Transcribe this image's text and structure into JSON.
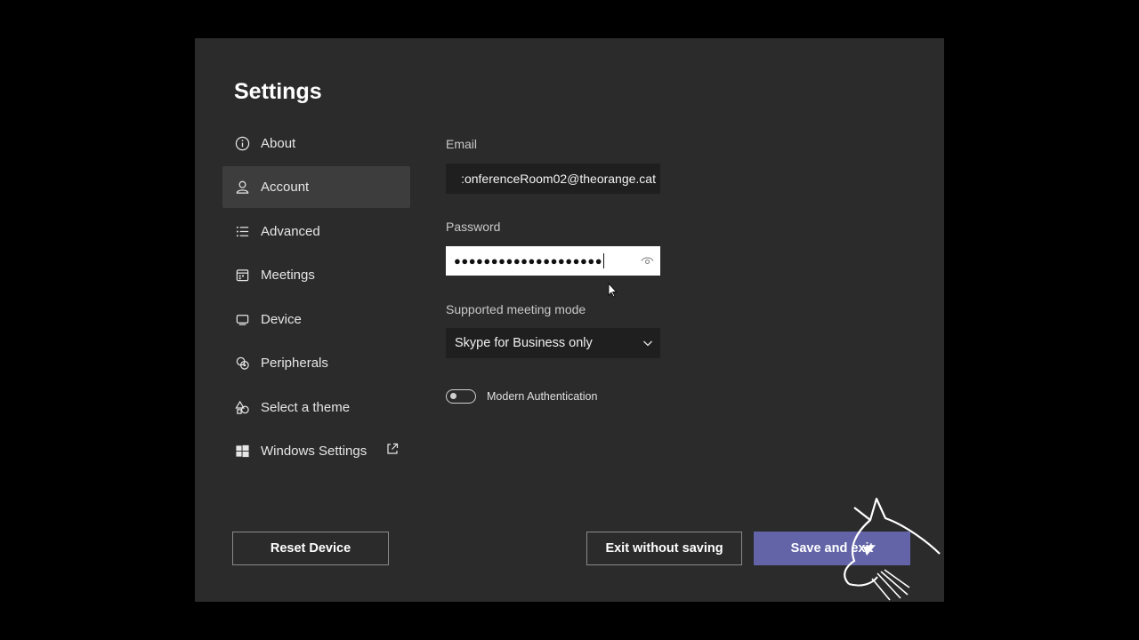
{
  "page": {
    "title": "Settings"
  },
  "sidebar": {
    "items": [
      {
        "label": "About",
        "icon": "info-icon"
      },
      {
        "label": "Account",
        "icon": "person-icon",
        "active": true
      },
      {
        "label": "Advanced",
        "icon": "list-icon"
      },
      {
        "label": "Meetings",
        "icon": "calendar-icon"
      },
      {
        "label": "Device",
        "icon": "device-icon"
      },
      {
        "label": "Peripherals",
        "icon": "peripherals-icon"
      },
      {
        "label": "Select a theme",
        "icon": "shapes-icon"
      },
      {
        "label": "Windows Settings",
        "icon": "windows-icon",
        "external": true
      }
    ]
  },
  "account": {
    "email_label": "Email",
    "email_value": ":onferenceRoom02@theorange.cat",
    "password_label": "Password",
    "password_masked": "●●●●●●●●●●●●●●●●●●●●",
    "mode_label": "Supported meeting mode",
    "mode_value": "Skype for Business only",
    "modern_auth_label": "Modern Authentication",
    "modern_auth_on": false
  },
  "footer": {
    "reset_label": "Reset Device",
    "exit_label": "Exit without saving",
    "save_label": "Save and exit"
  },
  "colors": {
    "panel": "#2b2b2b",
    "active_nav": "#3d3d3d",
    "primary": "#6264a7",
    "input_dark": "#1f1f1f"
  }
}
